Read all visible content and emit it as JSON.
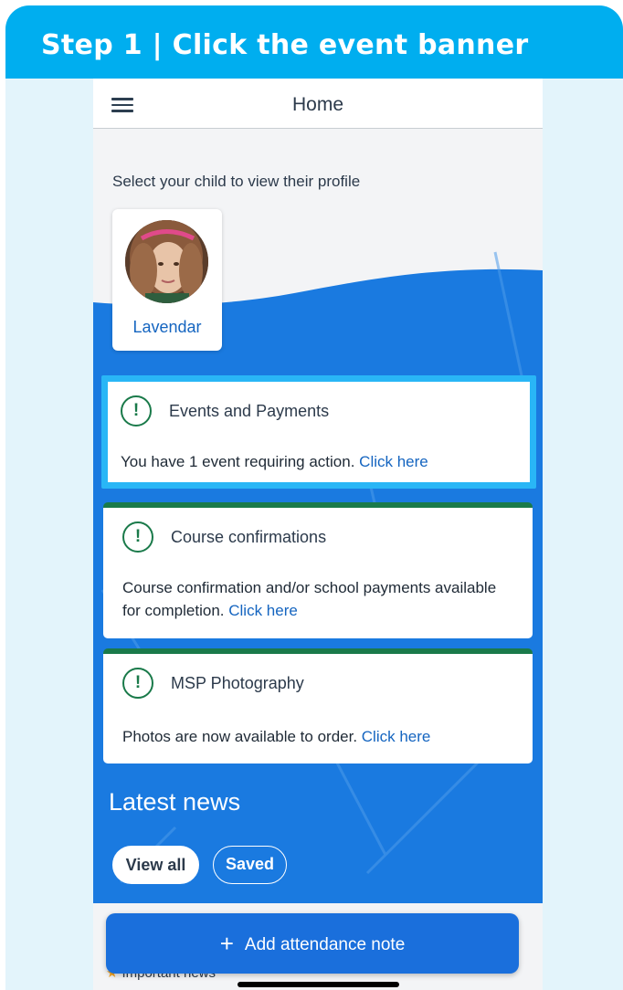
{
  "step": {
    "title": "Step 1 | Click the event banner"
  },
  "appbar": {
    "title": "Home"
  },
  "profile": {
    "prompt": "Select your child to view their profile",
    "child_name": "Lavendar"
  },
  "cards": [
    {
      "title": "Events and Payments",
      "text": "You have 1 event requiring action. ",
      "link": "Click here"
    },
    {
      "title": "Course confirmations",
      "text": "Course confirmation and/or school payments available for completion. ",
      "link": "Click here"
    },
    {
      "title": "MSP Photography",
      "text": "Photos are now available to order. ",
      "link": "Click here"
    }
  ],
  "alert_icon": "!",
  "news": {
    "title": "Latest news",
    "tabs": [
      "View all",
      "Saved"
    ],
    "important_label": "Important news"
  },
  "attendance": {
    "plus": "+",
    "label": "Add attendance note"
  },
  "colors": {
    "step_header": "#00aeef",
    "primary_blue": "#1a6fdc",
    "highlight": "#29b6f6",
    "alert_green": "#1a7a4a",
    "link": "#1565c0"
  },
  "icons": {
    "menu": "hamburger-menu-icon",
    "alert": "exclamation-circle-icon",
    "star": "star-icon",
    "plus": "plus-icon"
  }
}
